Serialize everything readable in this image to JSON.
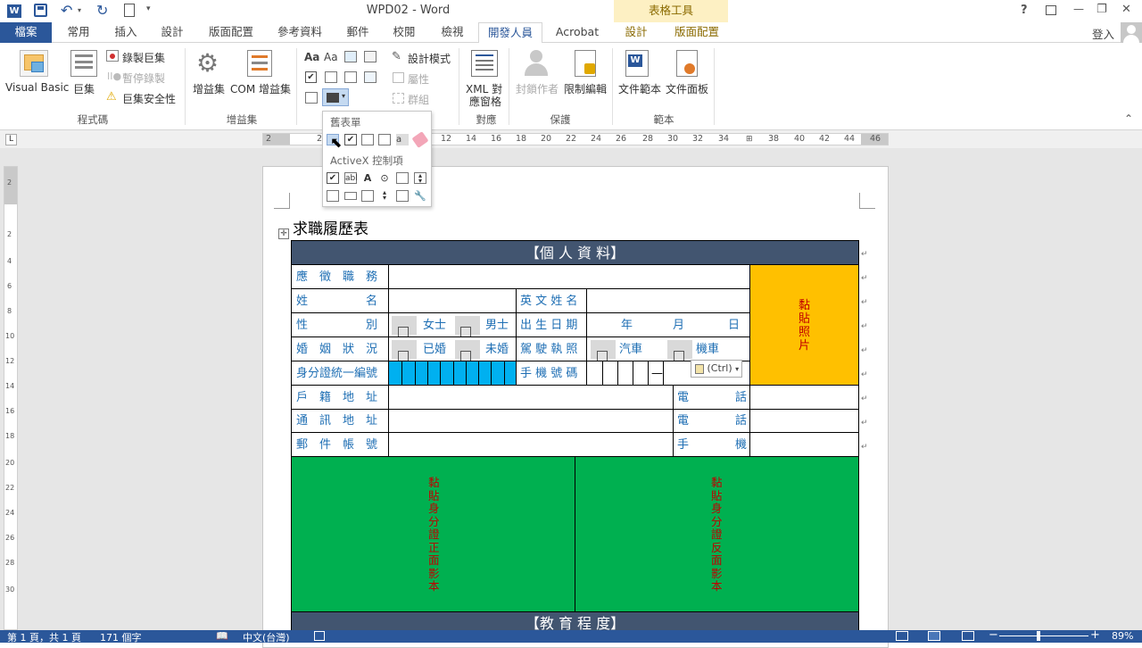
{
  "titlebar": {
    "title": "WPD02 - Word",
    "contextual_tab_title": "表格工具",
    "help": "?",
    "minimize": "—",
    "maximize": "❐",
    "close": "✕"
  },
  "tabs": [
    {
      "label": "檔案"
    },
    {
      "label": "常用"
    },
    {
      "label": "插入"
    },
    {
      "label": "設計"
    },
    {
      "label": "版面配置"
    },
    {
      "label": "參考資料"
    },
    {
      "label": "郵件"
    },
    {
      "label": "校閱"
    },
    {
      "label": "檢視"
    },
    {
      "label": "開發人員"
    },
    {
      "label": "Acrobat"
    },
    {
      "label": "設計"
    },
    {
      "label": "版面配置"
    }
  ],
  "signin": "登入",
  "ribbon": {
    "code": {
      "label": "程式碼",
      "visual_basic": "Visual Basic",
      "macros": "巨集",
      "record_macro": "錄製巨集",
      "pause_recording": "暫停錄製",
      "macro_security": "巨集安全性"
    },
    "addins": {
      "label": "增益集",
      "addins": "增益集",
      "com_addins": "COM 增益集"
    },
    "controls": {
      "design_mode": "設計模式",
      "properties": "屬性",
      "group": "群組"
    },
    "mapping": {
      "label": "對應",
      "xml_mapping_line1": "XML 對",
      "xml_mapping_line2": "應窗格"
    },
    "protect": {
      "label": "保護",
      "block_authors": "封鎖作者",
      "restrict_editing": "限制編輯"
    },
    "templates": {
      "label": "範本",
      "document_template": "文件範本",
      "document_panel": "文件面板"
    }
  },
  "dropdown": {
    "legacy_header": "舊表單",
    "activex_header": "ActiveX 控制項"
  },
  "ruler": {
    "ticks": [
      "2",
      "2",
      "12",
      "14",
      "16",
      "18",
      "20",
      "22",
      "24",
      "26",
      "28",
      "30",
      "32",
      "34",
      "38",
      "40",
      "42",
      "44",
      "46"
    ],
    "vticks": [
      "2",
      "2",
      "4",
      "6",
      "8",
      "10",
      "12",
      "14",
      "16",
      "18",
      "20",
      "22",
      "24",
      "26",
      "28",
      "30"
    ]
  },
  "document": {
    "heading": "求職履歷表",
    "section_personal": "【個 人 資 料】",
    "section_education": "【教 育 程 度】",
    "fields": {
      "applied_position": "應　徵　職　務",
      "name": "姓　　　　　名",
      "english_name": "英 文 姓 名",
      "gender": "性　　　　　別",
      "female": "女士",
      "male": "男士",
      "birthdate": "出 生 日 期",
      "year": "年",
      "month": "月",
      "day": "日",
      "marital": "婚　姻　狀　況",
      "married": "已婚",
      "single": "未婚",
      "license": "駕 駛 執 照",
      "car": "汽車",
      "motorcycle": "機車",
      "id_number": "身分證統一編號",
      "mobile_number": "手 機 號 碼",
      "dash": "—",
      "residence_address": "戶　籍　地　址",
      "phone": "電　　　　話",
      "mailing_address": "通　訊　地　址",
      "phone2": "電　　　　話",
      "postal_account": "郵　件　帳　號",
      "mobile": "手　　　　機",
      "photo": "黏貼照片",
      "id_front": "黏貼身分證正面影本",
      "id_back": "黏貼身分證反面影本"
    },
    "paste_options": "(Ctrl)"
  },
  "statusbar": {
    "page": "第 1 頁，共 1 頁",
    "words": "171 個字",
    "language": "中文(台灣)",
    "zoom": "89%"
  },
  "colors": {
    "accent": "#2b579a",
    "section_header": "#425570",
    "photo_fill": "#ffc000",
    "id_fill": "#00b050",
    "id_cells": "#00b0f0",
    "label_text": "#1f6fb4",
    "red_text": "#c00000"
  }
}
